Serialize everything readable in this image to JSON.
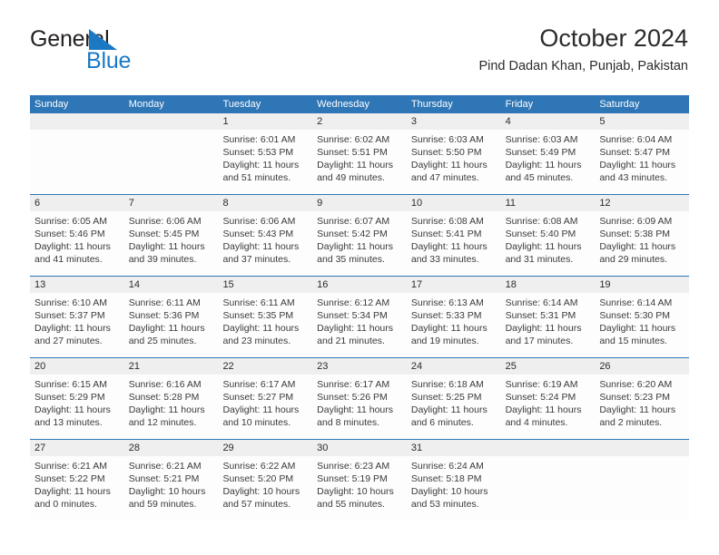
{
  "brand": {
    "name_part1": "General",
    "name_part2": "Blue",
    "flag_icon": "triangle-flag-icon",
    "accent_color": "#1b79c4"
  },
  "header": {
    "title": "October 2024",
    "subtitle": "Pind Dadan Khan, Punjab, Pakistan"
  },
  "calendar": {
    "header_color": "#2f76b6",
    "daynum_band_color": "#efefef",
    "weekdays": [
      "Sunday",
      "Monday",
      "Tuesday",
      "Wednesday",
      "Thursday",
      "Friday",
      "Saturday"
    ],
    "weeks": [
      [
        {
          "day": "",
          "empty": true,
          "sunrise": "",
          "sunset": "",
          "daylight": ""
        },
        {
          "day": "",
          "empty": true,
          "sunrise": "",
          "sunset": "",
          "daylight": ""
        },
        {
          "day": "1",
          "empty": false,
          "sunrise": "Sunrise: 6:01 AM",
          "sunset": "Sunset: 5:53 PM",
          "daylight": "Daylight: 11 hours and 51 minutes."
        },
        {
          "day": "2",
          "empty": false,
          "sunrise": "Sunrise: 6:02 AM",
          "sunset": "Sunset: 5:51 PM",
          "daylight": "Daylight: 11 hours and 49 minutes."
        },
        {
          "day": "3",
          "empty": false,
          "sunrise": "Sunrise: 6:03 AM",
          "sunset": "Sunset: 5:50 PM",
          "daylight": "Daylight: 11 hours and 47 minutes."
        },
        {
          "day": "4",
          "empty": false,
          "sunrise": "Sunrise: 6:03 AM",
          "sunset": "Sunset: 5:49 PM",
          "daylight": "Daylight: 11 hours and 45 minutes."
        },
        {
          "day": "5",
          "empty": false,
          "sunrise": "Sunrise: 6:04 AM",
          "sunset": "Sunset: 5:47 PM",
          "daylight": "Daylight: 11 hours and 43 minutes."
        }
      ],
      [
        {
          "day": "6",
          "empty": false,
          "sunrise": "Sunrise: 6:05 AM",
          "sunset": "Sunset: 5:46 PM",
          "daylight": "Daylight: 11 hours and 41 minutes."
        },
        {
          "day": "7",
          "empty": false,
          "sunrise": "Sunrise: 6:06 AM",
          "sunset": "Sunset: 5:45 PM",
          "daylight": "Daylight: 11 hours and 39 minutes."
        },
        {
          "day": "8",
          "empty": false,
          "sunrise": "Sunrise: 6:06 AM",
          "sunset": "Sunset: 5:43 PM",
          "daylight": "Daylight: 11 hours and 37 minutes."
        },
        {
          "day": "9",
          "empty": false,
          "sunrise": "Sunrise: 6:07 AM",
          "sunset": "Sunset: 5:42 PM",
          "daylight": "Daylight: 11 hours and 35 minutes."
        },
        {
          "day": "10",
          "empty": false,
          "sunrise": "Sunrise: 6:08 AM",
          "sunset": "Sunset: 5:41 PM",
          "daylight": "Daylight: 11 hours and 33 minutes."
        },
        {
          "day": "11",
          "empty": false,
          "sunrise": "Sunrise: 6:08 AM",
          "sunset": "Sunset: 5:40 PM",
          "daylight": "Daylight: 11 hours and 31 minutes."
        },
        {
          "day": "12",
          "empty": false,
          "sunrise": "Sunrise: 6:09 AM",
          "sunset": "Sunset: 5:38 PM",
          "daylight": "Daylight: 11 hours and 29 minutes."
        }
      ],
      [
        {
          "day": "13",
          "empty": false,
          "sunrise": "Sunrise: 6:10 AM",
          "sunset": "Sunset: 5:37 PM",
          "daylight": "Daylight: 11 hours and 27 minutes."
        },
        {
          "day": "14",
          "empty": false,
          "sunrise": "Sunrise: 6:11 AM",
          "sunset": "Sunset: 5:36 PM",
          "daylight": "Daylight: 11 hours and 25 minutes."
        },
        {
          "day": "15",
          "empty": false,
          "sunrise": "Sunrise: 6:11 AM",
          "sunset": "Sunset: 5:35 PM",
          "daylight": "Daylight: 11 hours and 23 minutes."
        },
        {
          "day": "16",
          "empty": false,
          "sunrise": "Sunrise: 6:12 AM",
          "sunset": "Sunset: 5:34 PM",
          "daylight": "Daylight: 11 hours and 21 minutes."
        },
        {
          "day": "17",
          "empty": false,
          "sunrise": "Sunrise: 6:13 AM",
          "sunset": "Sunset: 5:33 PM",
          "daylight": "Daylight: 11 hours and 19 minutes."
        },
        {
          "day": "18",
          "empty": false,
          "sunrise": "Sunrise: 6:14 AM",
          "sunset": "Sunset: 5:31 PM",
          "daylight": "Daylight: 11 hours and 17 minutes."
        },
        {
          "day": "19",
          "empty": false,
          "sunrise": "Sunrise: 6:14 AM",
          "sunset": "Sunset: 5:30 PM",
          "daylight": "Daylight: 11 hours and 15 minutes."
        }
      ],
      [
        {
          "day": "20",
          "empty": false,
          "sunrise": "Sunrise: 6:15 AM",
          "sunset": "Sunset: 5:29 PM",
          "daylight": "Daylight: 11 hours and 13 minutes."
        },
        {
          "day": "21",
          "empty": false,
          "sunrise": "Sunrise: 6:16 AM",
          "sunset": "Sunset: 5:28 PM",
          "daylight": "Daylight: 11 hours and 12 minutes."
        },
        {
          "day": "22",
          "empty": false,
          "sunrise": "Sunrise: 6:17 AM",
          "sunset": "Sunset: 5:27 PM",
          "daylight": "Daylight: 11 hours and 10 minutes."
        },
        {
          "day": "23",
          "empty": false,
          "sunrise": "Sunrise: 6:17 AM",
          "sunset": "Sunset: 5:26 PM",
          "daylight": "Daylight: 11 hours and 8 minutes."
        },
        {
          "day": "24",
          "empty": false,
          "sunrise": "Sunrise: 6:18 AM",
          "sunset": "Sunset: 5:25 PM",
          "daylight": "Daylight: 11 hours and 6 minutes."
        },
        {
          "day": "25",
          "empty": false,
          "sunrise": "Sunrise: 6:19 AM",
          "sunset": "Sunset: 5:24 PM",
          "daylight": "Daylight: 11 hours and 4 minutes."
        },
        {
          "day": "26",
          "empty": false,
          "sunrise": "Sunrise: 6:20 AM",
          "sunset": "Sunset: 5:23 PM",
          "daylight": "Daylight: 11 hours and 2 minutes."
        }
      ],
      [
        {
          "day": "27",
          "empty": false,
          "sunrise": "Sunrise: 6:21 AM",
          "sunset": "Sunset: 5:22 PM",
          "daylight": "Daylight: 11 hours and 0 minutes."
        },
        {
          "day": "28",
          "empty": false,
          "sunrise": "Sunrise: 6:21 AM",
          "sunset": "Sunset: 5:21 PM",
          "daylight": "Daylight: 10 hours and 59 minutes."
        },
        {
          "day": "29",
          "empty": false,
          "sunrise": "Sunrise: 6:22 AM",
          "sunset": "Sunset: 5:20 PM",
          "daylight": "Daylight: 10 hours and 57 minutes."
        },
        {
          "day": "30",
          "empty": false,
          "sunrise": "Sunrise: 6:23 AM",
          "sunset": "Sunset: 5:19 PM",
          "daylight": "Daylight: 10 hours and 55 minutes."
        },
        {
          "day": "31",
          "empty": false,
          "sunrise": "Sunrise: 6:24 AM",
          "sunset": "Sunset: 5:18 PM",
          "daylight": "Daylight: 10 hours and 53 minutes."
        },
        {
          "day": "",
          "empty": true,
          "sunrise": "",
          "sunset": "",
          "daylight": ""
        },
        {
          "day": "",
          "empty": true,
          "sunrise": "",
          "sunset": "",
          "daylight": ""
        }
      ]
    ]
  }
}
